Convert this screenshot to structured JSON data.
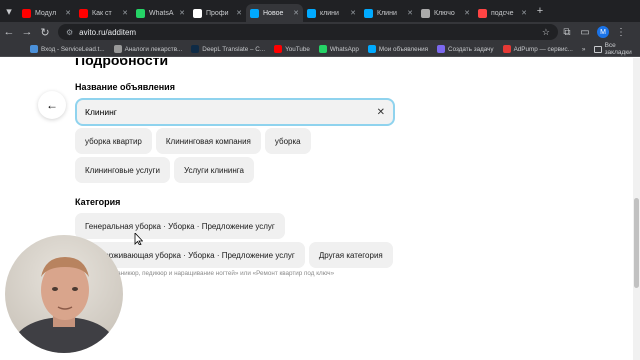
{
  "browser": {
    "tabs": [
      {
        "label": "Модул",
        "color": "#ff0000"
      },
      {
        "label": "Как ст",
        "color": "#ff0000"
      },
      {
        "label": "WhatsA",
        "color": "#25d366"
      },
      {
        "label": "Профи",
        "color": "#ffffff"
      },
      {
        "label": "Новое",
        "color": "#00aaff"
      },
      {
        "label": "клини",
        "color": "#00aaff"
      },
      {
        "label": "Клини",
        "color": "#00aaff"
      },
      {
        "label": "Ключо",
        "color": "#aaaaaa"
      },
      {
        "label": "подсче",
        "color": "#ff4444"
      }
    ],
    "active_tab": 4,
    "url": "avito.ru/additem",
    "profile_initial": "M",
    "bookmarks": [
      {
        "label": "Вход - ServiceLead.t...",
        "color": "#4a90d9"
      },
      {
        "label": "Аналоги лекарств...",
        "color": "#999999"
      },
      {
        "label": "DeepL Translate – С...",
        "color": "#0f2b46"
      },
      {
        "label": "YouTube",
        "color": "#ff0000"
      },
      {
        "label": "WhatsApp",
        "color": "#25d366"
      },
      {
        "label": "Мои объявления",
        "color": "#00aaff"
      },
      {
        "label": "Создать задачу",
        "color": "#7b68ee"
      },
      {
        "label": "AdPump — сервис...",
        "color": "#e53935"
      }
    ],
    "all_bookmarks_label": "Все закладки"
  },
  "page": {
    "heading": "Подробности",
    "title_field": {
      "label": "Название объявления",
      "value": "Клининг"
    },
    "suggestions": [
      [
        "уборка квартир",
        "Клининговая компания",
        "уборка"
      ],
      [
        "Клининговые услуги",
        "Услуги клининга"
      ]
    ],
    "category": {
      "label": "Категория",
      "options": [
        "Генеральная уборка · Уборка · Предложение услуг",
        "Поддерживающая уборка · Уборка · Предложение услуг",
        "Другая категория"
      ],
      "hint": "Например: «Маникюр, педикюр и наращивание ногтей» или «Ремонт квартир под ключ»"
    }
  }
}
